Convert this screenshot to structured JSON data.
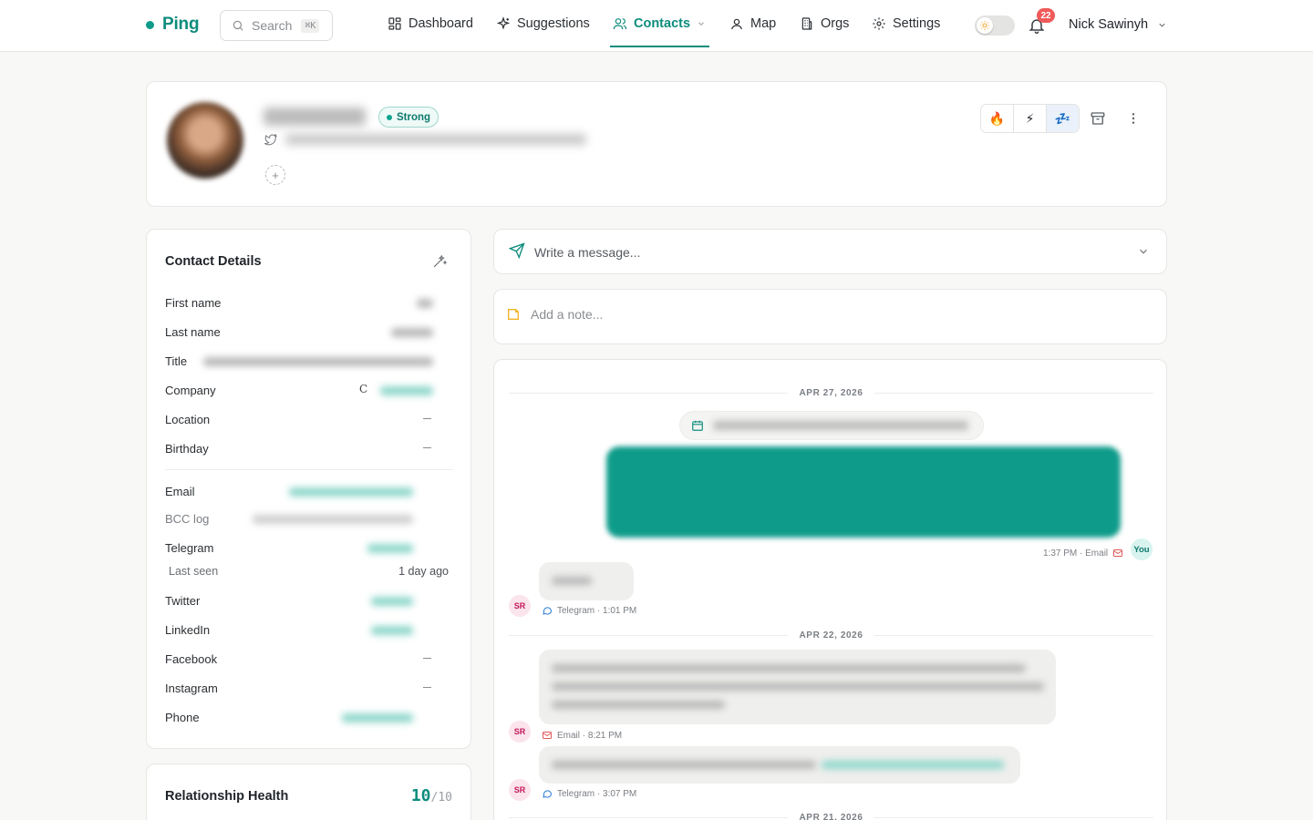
{
  "brand": {
    "name": "Ping",
    "accent": "#0e8c7d"
  },
  "search": {
    "placeholder": "Search",
    "shortcut": "⌘K"
  },
  "nav": {
    "items": [
      {
        "label": "Dashboard",
        "icon": "dashboard-icon"
      },
      {
        "label": "Suggestions",
        "icon": "sparkle-icon"
      },
      {
        "label": "Contacts",
        "icon": "contacts-icon",
        "active": true
      },
      {
        "label": "Map",
        "icon": "map-pin-icon"
      },
      {
        "label": "Orgs",
        "icon": "building-icon"
      },
      {
        "label": "Settings",
        "icon": "gear-icon"
      }
    ],
    "notifications_count": "22",
    "user_name": "Nick Sawinyh"
  },
  "profile": {
    "strength_badge": "Strong",
    "add_tag": "+",
    "priority_buttons": [
      "🔥",
      "⚡",
      "💤"
    ]
  },
  "details": {
    "title": "Contact Details",
    "rows": {
      "first_name": "First name",
      "last_name": "Last name",
      "title": "Title",
      "company": "Company",
      "company_logo": "C",
      "location": "Location",
      "birthday": "Birthday",
      "email": "Email",
      "bcc_log": "BCC log",
      "telegram": "Telegram",
      "last_seen": "Last seen",
      "last_seen_value": "1 day ago",
      "twitter": "Twitter",
      "linkedin": "LinkedIn",
      "facebook": "Facebook",
      "instagram": "Instagram",
      "phone": "Phone"
    }
  },
  "health": {
    "title": "Relationship Health",
    "score": "10",
    "max": "/10"
  },
  "composer": {
    "placeholder": "Write a message..."
  },
  "note": {
    "placeholder": "Add a note..."
  },
  "timeline": {
    "dates": [
      "APR 27, 2026",
      "APR 22, 2026",
      "APR 21, 2026"
    ],
    "outgoing_meta": "1:37 PM · Email",
    "you_label": "You",
    "sender_initials": "SR",
    "messages_meta": [
      "Telegram · 1:01 PM",
      "Email · 8:21 PM",
      "Telegram · 3:07 PM"
    ]
  }
}
